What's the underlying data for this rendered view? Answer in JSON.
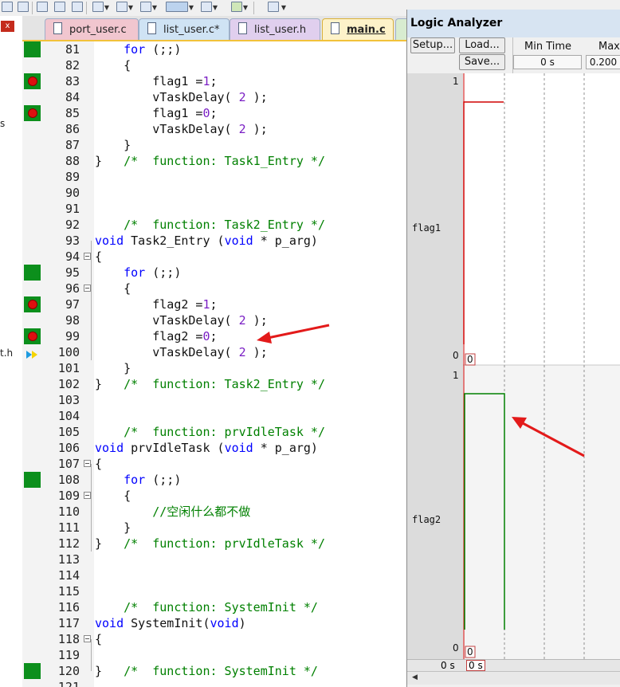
{
  "editor": {
    "tabs": [
      {
        "label": "port_user.c"
      },
      {
        "label": "list_user.c*"
      },
      {
        "label": "list_user.h"
      },
      {
        "label": "main.c"
      }
    ],
    "lines": [
      {
        "n": "81",
        "code": "    for (;;)"
      },
      {
        "n": "82",
        "code": "    {"
      },
      {
        "n": "83",
        "code": "        flag1 =1;"
      },
      {
        "n": "84",
        "code": "        vTaskDelay( 2 );"
      },
      {
        "n": "85",
        "code": "        flag1 =0;"
      },
      {
        "n": "86",
        "code": "        vTaskDelay( 2 );"
      },
      {
        "n": "87",
        "code": "    }"
      },
      {
        "n": "88",
        "code": "}   /*  function: Task1_Entry */"
      },
      {
        "n": "89",
        "code": ""
      },
      {
        "n": "90",
        "code": ""
      },
      {
        "n": "91",
        "code": ""
      },
      {
        "n": "92",
        "code": "    /*  function: Task2_Entry */"
      },
      {
        "n": "93",
        "code": "void Task2_Entry (void * p_arg)"
      },
      {
        "n": "94",
        "code": "{"
      },
      {
        "n": "95",
        "code": "    for (;;)"
      },
      {
        "n": "96",
        "code": "    {"
      },
      {
        "n": "97",
        "code": "        flag2 =1;"
      },
      {
        "n": "98",
        "code": "        vTaskDelay( 2 );"
      },
      {
        "n": "99",
        "code": "        flag2 =0;"
      },
      {
        "n": "100",
        "code": "        vTaskDelay( 2 );"
      },
      {
        "n": "101",
        "code": "    }"
      },
      {
        "n": "102",
        "code": "}   /*  function: Task2_Entry */"
      },
      {
        "n": "103",
        "code": ""
      },
      {
        "n": "104",
        "code": ""
      },
      {
        "n": "105",
        "code": "    /*  function: prvIdleTask */"
      },
      {
        "n": "106",
        "code": "void prvIdleTask (void * p_arg)"
      },
      {
        "n": "107",
        "code": "{"
      },
      {
        "n": "108",
        "code": "    for (;;)"
      },
      {
        "n": "109",
        "code": "    {"
      },
      {
        "n": "110",
        "code": "        //空闲什么都不做"
      },
      {
        "n": "111",
        "code": "    }"
      },
      {
        "n": "112",
        "code": "}   /*  function: prvIdleTask */"
      },
      {
        "n": "113",
        "code": ""
      },
      {
        "n": "114",
        "code": ""
      },
      {
        "n": "115",
        "code": ""
      },
      {
        "n": "116",
        "code": "    /*  function: SystemInit */"
      },
      {
        "n": "117",
        "code": "void SystemInit(void)"
      },
      {
        "n": "118",
        "code": "{"
      },
      {
        "n": "119",
        "code": ""
      },
      {
        "n": "120",
        "code": "}   /*  function: SystemInit */"
      },
      {
        "n": "121",
        "code": ""
      }
    ]
  },
  "left_pane": {
    "close_label": "x",
    "fragments": [
      "s",
      "t.h"
    ]
  },
  "logic_analyzer": {
    "title": "Logic Analyzer",
    "buttons": {
      "setup": "Setup...",
      "load": "Load...",
      "save": "Save..."
    },
    "min_time_label": "Min Time",
    "min_time_value": "0 s",
    "max_time_label": "Max",
    "max_time_value": "0.200",
    "signals": [
      {
        "name": "flag1",
        "max_label": "1",
        "min_label": "0",
        "color": "#d00000"
      },
      {
        "name": "flag2",
        "max_label": "1",
        "min_label": "0",
        "color": "#008000"
      }
    ],
    "time_axis": {
      "start_label": "0 s",
      "cursor_label": "0 s"
    }
  },
  "colors": {
    "annotation_arrow": "#e31a1a",
    "coverage": "#0c8f1c",
    "breakpoint": "#dd1010"
  }
}
